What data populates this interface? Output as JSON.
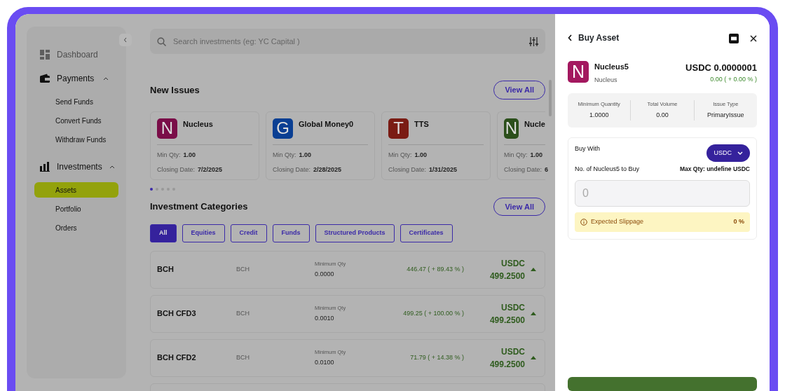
{
  "sidebar": {
    "items": [
      {
        "kind": "link",
        "label": "Dashboard",
        "disabled": true
      },
      {
        "kind": "group",
        "label": "Payments",
        "expanded": true,
        "children": [
          {
            "label": "Send Funds",
            "selected": false
          },
          {
            "label": "Convert Funds",
            "selected": false
          },
          {
            "label": "Withdraw Funds",
            "selected": false
          }
        ]
      },
      {
        "kind": "group",
        "label": "Investments",
        "expanded": true,
        "children": [
          {
            "label": "Assets",
            "selected": true
          },
          {
            "label": "Portfolio",
            "selected": false
          },
          {
            "label": "Orders",
            "selected": false
          }
        ]
      }
    ]
  },
  "search": {
    "placeholder": "Search investments (eg: YC Capital )"
  },
  "new_issues": {
    "title": "New Issues",
    "view_all": "View All",
    "cards": [
      {
        "letter": "N",
        "color": "#7a0d48",
        "name": "Nucleus",
        "min_qty_label": "Min Qty:",
        "min_qty": "1.00",
        "closing_label": "Closing Date:",
        "closing": "7/2/2025"
      },
      {
        "letter": "G",
        "color": "#0a3f93",
        "name": "Global Money0",
        "min_qty_label": "Min Qty:",
        "min_qty": "1.00",
        "closing_label": "Closing Date:",
        "closing": "2/28/2025"
      },
      {
        "letter": "T",
        "color": "#7a1c14",
        "name": "TTS",
        "min_qty_label": "Min Qty:",
        "min_qty": "1.00",
        "closing_label": "Closing Date:",
        "closing": "1/31/2025"
      },
      {
        "letter": "N",
        "color": "#2b4f1b",
        "name": "Nucle",
        "min_qty_label": "Min Qty:",
        "min_qty": "1.00",
        "closing_label": "Closing Date:",
        "closing": "6"
      }
    ],
    "dots": [
      {
        "selected": true
      },
      {
        "selected": false
      },
      {
        "selected": false
      },
      {
        "selected": false
      },
      {
        "selected": false
      }
    ]
  },
  "categories": {
    "title": "Investment Categories",
    "view_all": "View All",
    "filters": [
      {
        "label": "All",
        "selected": true
      },
      {
        "label": "Equities",
        "selected": false
      },
      {
        "label": "Credit",
        "selected": false
      },
      {
        "label": "Funds",
        "selected": false
      },
      {
        "label": "Structured Products",
        "selected": false
      },
      {
        "label": "Certificates",
        "selected": false
      }
    ],
    "rows": [
      {
        "name": "BCH",
        "symbol": "BCH",
        "min_label": "Minimum Qty",
        "min": "0.0000",
        "change": "446.47 ( + 89.43 % )",
        "currency": "USDC",
        "price": "499.2500"
      },
      {
        "name": "BCH CFD3",
        "symbol": "BCH",
        "min_label": "Minimum Qty",
        "min": "0.0010",
        "change": "499.25 ( + 100.00 % )",
        "currency": "USDC",
        "price": "499.2500"
      },
      {
        "name": "BCH CFD2",
        "symbol": "BCH",
        "min_label": "Minimum Qty",
        "min": "0.0100",
        "change": "71.79 ( + 14.38 % )",
        "currency": "USDC",
        "price": "499.2500"
      }
    ]
  },
  "drawer": {
    "title": "Buy Asset",
    "asset": {
      "letter": "N",
      "color": "#a3185f",
      "name": "Nucleus5",
      "issuer": "Nucleus",
      "price": "USDC 0.0000001",
      "change": "0.00 ( + 0.00 % )"
    },
    "stats": [
      {
        "label": "Minimum Quantity",
        "value": "1.0000"
      },
      {
        "label": "Total Volume",
        "value": "0.00"
      },
      {
        "label": "Issue Type",
        "value": "PrimaryIssue"
      }
    ],
    "buy_with_label": "Buy With",
    "currency": "USDC",
    "qty_label": "No. of Nucleus5 to Buy",
    "max_qty": "Max Qty: undefine USDC",
    "amount_placeholder": "0",
    "slippage_label": "Expected Slippage",
    "slippage": "0 %"
  }
}
